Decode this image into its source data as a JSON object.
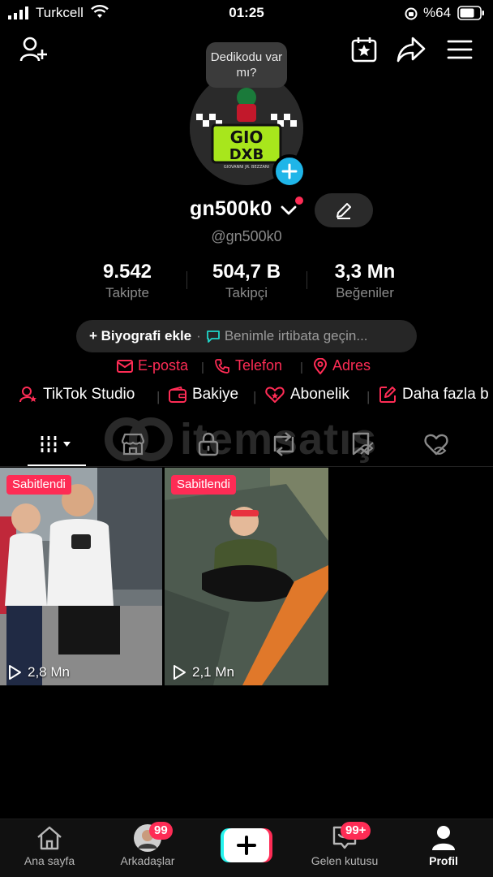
{
  "status_bar": {
    "carrier": "Turkcell",
    "time": "01:25",
    "battery": "%64"
  },
  "header": {
    "add_friend_icon": "person-add-icon",
    "calendar_icon": "calendar-star-icon",
    "share_icon": "share-icon",
    "menu_icon": "hamburger-menu-icon"
  },
  "profile": {
    "tooltip": "Dedikodu var mı?",
    "avatar_text": "GIO DXB",
    "avatar_subtext": "GIOVANNI JR. BEZZANI",
    "display_name": "gn500k0",
    "username": "@gn500k0",
    "stats": [
      {
        "value": "9.542",
        "label": "Takipte"
      },
      {
        "value": "504,7 B",
        "label": "Takipçi"
      },
      {
        "value": "3,3 Mn",
        "label": "Beğeniler"
      }
    ],
    "bio_add": "+ Biyografi ekle",
    "bio_separator": "·",
    "bio_contact": "Benimle irtibata geçin..."
  },
  "contacts": [
    {
      "label": "E-posta",
      "icon": "mail-icon"
    },
    {
      "label": "Telefon",
      "icon": "phone-icon"
    },
    {
      "label": "Adres",
      "icon": "location-pin-icon"
    }
  ],
  "tools": [
    {
      "label": "TikTok Studio",
      "icon": "studio-icon"
    },
    {
      "label": "Bakiye",
      "icon": "wallet-icon"
    },
    {
      "label": "Abonelik",
      "icon": "subscription-icon"
    },
    {
      "label": "Daha fazla b",
      "icon": "edit-box-icon"
    }
  ],
  "watermark": "itemsatış",
  "tabs": [
    {
      "name": "grid-tab",
      "icon": "grid-icon",
      "active": true
    },
    {
      "name": "shop-tab",
      "icon": "shop-icon"
    },
    {
      "name": "private-tab",
      "icon": "lock-icon"
    },
    {
      "name": "repost-tab",
      "icon": "repost-icon"
    },
    {
      "name": "saved-tab",
      "icon": "bookmark-icon"
    },
    {
      "name": "liked-tab",
      "icon": "heart-hidden-icon"
    }
  ],
  "videos": [
    {
      "pinned_label": "Sabitlendi",
      "views": "2,8 Mn"
    },
    {
      "pinned_label": "Sabitlendi",
      "views": "2,1 Mn"
    }
  ],
  "bottom_nav": [
    {
      "label": "Ana sayfa",
      "icon": "home-icon"
    },
    {
      "label": "Arkadaşlar",
      "icon": "friends-avatar-icon",
      "badge": "99"
    },
    {
      "label": "",
      "icon": "create-plus-icon"
    },
    {
      "label": "Gelen kutusu",
      "icon": "inbox-icon",
      "badge": "99+"
    },
    {
      "label": "Profil",
      "icon": "profile-icon",
      "active": true
    }
  ],
  "colors": {
    "accent": "#fe2c55",
    "background": "#000000",
    "secondary_text": "#8a8a8a",
    "plus_badge": "#1fb5e8"
  }
}
